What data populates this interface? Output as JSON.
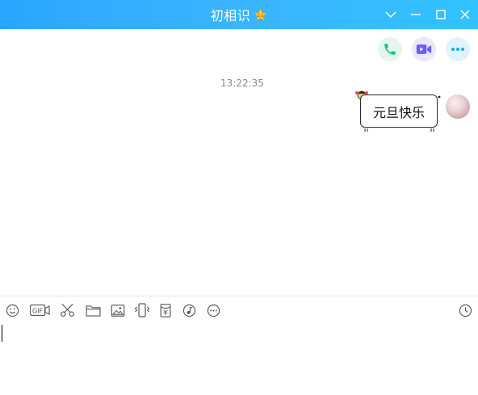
{
  "window": {
    "title": "初相识",
    "title_star_icon": "star-badge-icon",
    "controls": [
      "chevron-down-icon",
      "minimize-icon",
      "maximize-icon",
      "close-icon"
    ],
    "titlebar_color": "#2aa6ff"
  },
  "call_actions": [
    {
      "name": "voice-call",
      "icon": "phone-icon",
      "color": "#19c37d"
    },
    {
      "name": "video-call",
      "icon": "video-camera-icon",
      "color": "#6c5cff"
    },
    {
      "name": "more",
      "icon": "more-dots-icon",
      "color": "#18a8e8"
    }
  ],
  "conversation": {
    "timestamp": "13:22:35",
    "messages": [
      {
        "sender": "self",
        "text": "元旦快乐",
        "bubble_style": "themed-sticker-bubble"
      }
    ]
  },
  "composer": {
    "tools": [
      "emoji-icon",
      "gif-icon",
      "scissors-icon",
      "folder-icon",
      "image-icon",
      "shake-icon",
      "red-packet-icon",
      "music-icon",
      "more-circle-icon"
    ],
    "history_icon": "clock-icon",
    "input_value": ""
  }
}
